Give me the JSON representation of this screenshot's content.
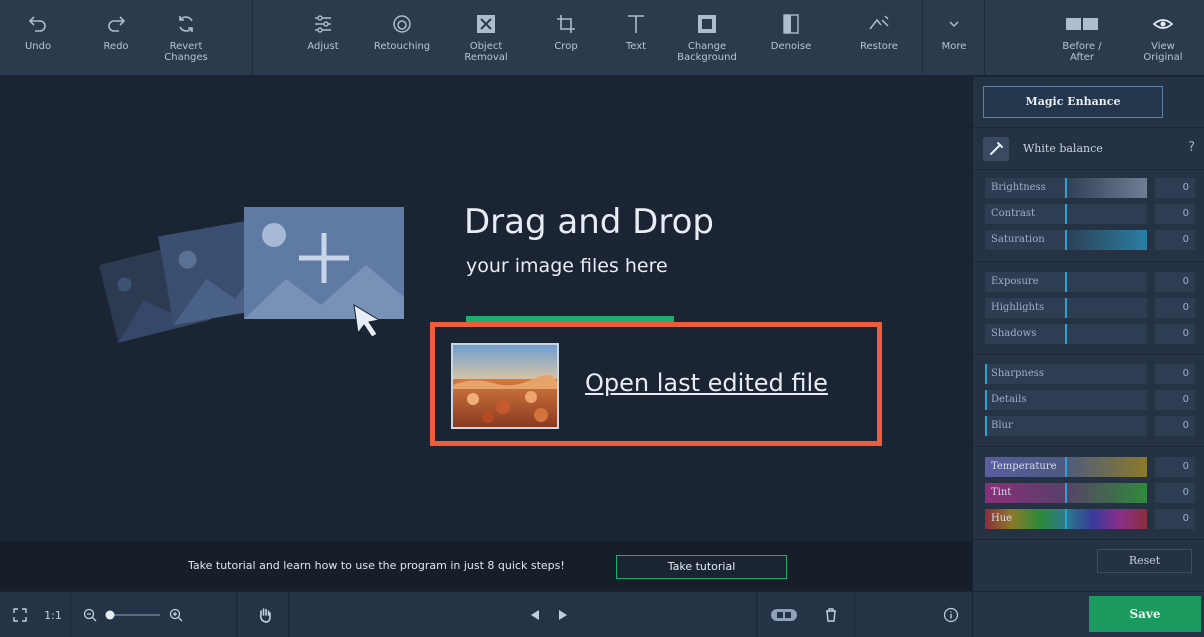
{
  "toolbar": {
    "undo": "Undo",
    "redo": "Redo",
    "revert": "Revert\nChanges",
    "adjust": "Adjust",
    "retouching": "Retouching",
    "object_removal": "Object\nRemoval",
    "crop": "Crop",
    "text": "Text",
    "change_background": "Change\nBackground",
    "denoise": "Denoise",
    "restore": "Restore",
    "more": "More",
    "before_after": "Before /\nAfter",
    "view_original": "View\nOriginal"
  },
  "canvas": {
    "title": "Drag and Drop",
    "subtitle": "your image files here",
    "open_last": "Open last edited file"
  },
  "tutorial": {
    "text": "Take tutorial and learn how to use the program in just 8 quick steps!",
    "button": "Take tutorial"
  },
  "bottom": {
    "one_to_one": "1:1"
  },
  "right_panel": {
    "magic_enhance": "Magic Enhance",
    "white_balance": "White balance",
    "help": "?",
    "sliders": [
      {
        "label": "Brightness",
        "value": "0"
      },
      {
        "label": "Contrast",
        "value": "0"
      },
      {
        "label": "Saturation",
        "value": "0"
      },
      {
        "label": "Exposure",
        "value": "0"
      },
      {
        "label": "Highlights",
        "value": "0"
      },
      {
        "label": "Shadows",
        "value": "0"
      },
      {
        "label": "Sharpness",
        "value": "0"
      },
      {
        "label": "Details",
        "value": "0"
      },
      {
        "label": "Blur",
        "value": "0"
      },
      {
        "label": "Temperature",
        "value": "0"
      },
      {
        "label": "Tint",
        "value": "0"
      },
      {
        "label": "Hue",
        "value": "0"
      }
    ],
    "reset": "Reset",
    "save": "Save"
  },
  "colors": {
    "accent_green": "#1cae6b",
    "highlight_border": "#ef5c3c",
    "toolbar_bg": "#2b3a4d",
    "canvas_bg": "#1b2433"
  }
}
